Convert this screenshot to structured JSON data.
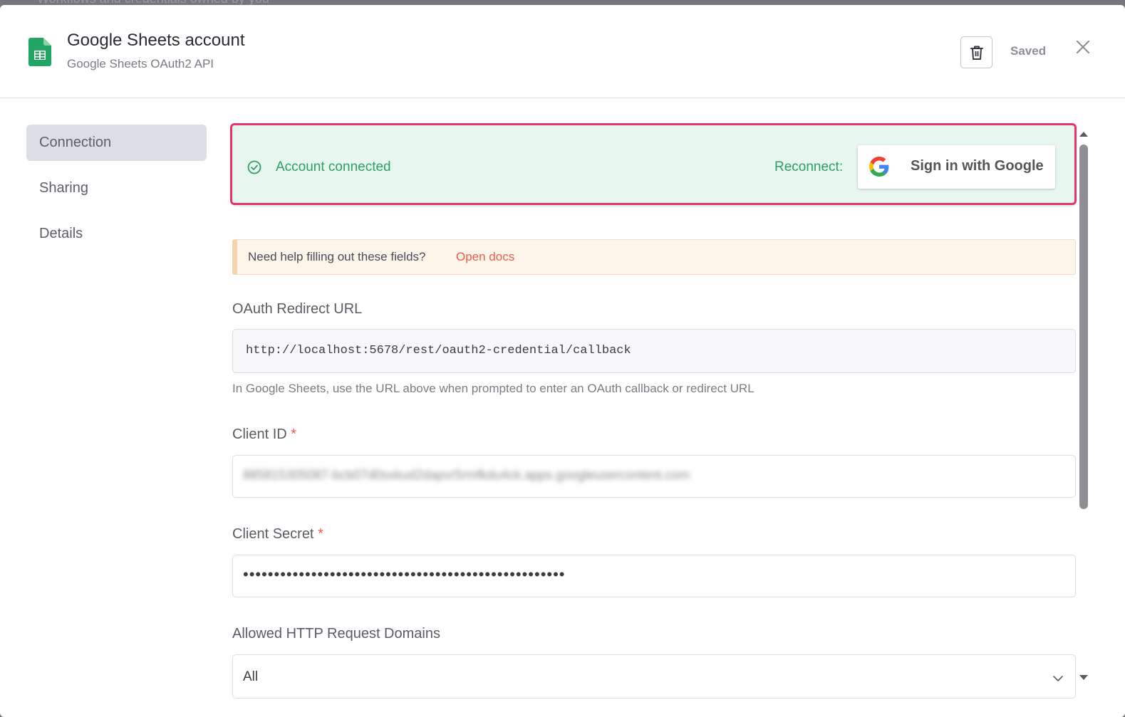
{
  "backdrop": {
    "text": "Workflows and credentials owned by you"
  },
  "header": {
    "title": "Google Sheets account",
    "subtitle": "Google Sheets OAuth2 API",
    "status": "Saved",
    "icons": {
      "app": "google-sheets-icon",
      "delete": "trash-icon",
      "close": "close-icon"
    }
  },
  "sidebar": {
    "items": [
      {
        "label": "Connection",
        "active": true
      },
      {
        "label": "Sharing",
        "active": false
      },
      {
        "label": "Details",
        "active": false
      }
    ]
  },
  "connection_banner": {
    "status": "Account connected",
    "reconnect_label": "Reconnect:",
    "google_button_label": "Sign in with Google"
  },
  "help": {
    "text": "Need help filling out these fields?",
    "link": "Open docs"
  },
  "fields": {
    "redirect_url": {
      "label": "OAuth Redirect URL",
      "value": "http://localhost:5678/rest/oauth2-credential/callback",
      "hint": "In Google Sheets, use the URL above when prompted to enter an OAuth callback or redirect URL"
    },
    "client_id": {
      "label": "Client ID",
      "required_mark": "*",
      "value": "885815305087-bcb07d0sxkud2dapvr5rmfkdu4ck.apps.googleusercontent.com"
    },
    "client_secret": {
      "label": "Client Secret",
      "required_mark": "*",
      "value": "••••••••••••••••••••••••••••••••••••••••••••••••••••"
    },
    "allowed_domains": {
      "label": "Allowed HTTP Request Domains",
      "value": "All"
    }
  },
  "colors": {
    "success": "#2f9e62",
    "success_bg": "#e7f7ef",
    "highlight": "#e8336a",
    "link": "#ea5d4d",
    "sheets_green": "#23a566"
  }
}
